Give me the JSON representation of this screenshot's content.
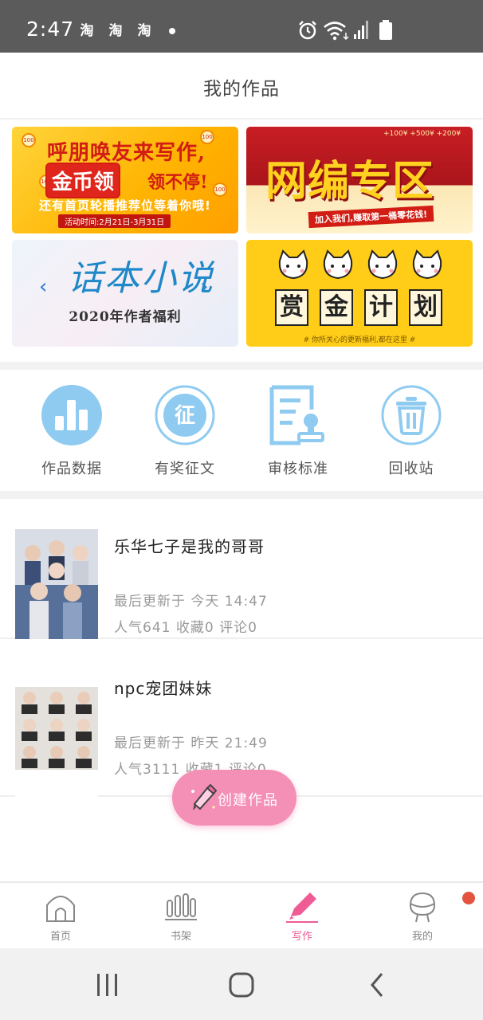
{
  "status_bar": {
    "time": "2:47",
    "app_icons": [
      "淘",
      "淘",
      "淘"
    ],
    "icons": [
      "alarm-icon",
      "wifi-icon",
      "signal-icon",
      "battery-icon"
    ]
  },
  "header": {
    "title": "我的作品"
  },
  "banners": [
    {
      "line1": "呼朋唤友来写作,",
      "highlight": "金币领",
      "tail": "领不停!",
      "line3": "还有首页轮播推荐位等着你哦!",
      "date": "活动时间:2月21日-3月31日"
    },
    {
      "title": "网编专区",
      "sub": "加入我们,赚取第一桶零花钱!",
      "money": "+100¥ +500¥ +200¥"
    },
    {
      "title": "话本小说",
      "sub": "2020年作者福利"
    },
    {
      "chars": [
        "赏",
        "金",
        "计",
        "划"
      ],
      "note": "# 你所关心的更新福利,都在这里 #"
    }
  ],
  "actions": [
    {
      "label": "作品数据",
      "icon": "bar-chart-icon"
    },
    {
      "label": "有奖征文",
      "icon": "contest-icon"
    },
    {
      "label": "审核标准",
      "icon": "review-document-icon"
    },
    {
      "label": "回收站",
      "icon": "trash-icon"
    }
  ],
  "works": [
    {
      "title": "乐华七子是我的哥哥",
      "updated": "最后更新于 今天 14:47",
      "stats": "人气641 收藏0 评论0"
    },
    {
      "title": "npc宠团妹妹",
      "updated": "最后更新于 昨天 21:49",
      "stats": "人气3111 收藏1 评论0"
    }
  ],
  "fab": {
    "label": "创建作品",
    "icon": "pencil-icon"
  },
  "tabs": [
    {
      "label": "首页",
      "icon": "home-icon",
      "active": false
    },
    {
      "label": "书架",
      "icon": "bookshelf-icon",
      "active": false
    },
    {
      "label": "写作",
      "icon": "write-pencil-icon",
      "active": true
    },
    {
      "label": "我的",
      "icon": "profile-icon",
      "active": false
    }
  ],
  "nav": [
    "recents-icon",
    "home-button-icon",
    "back-icon"
  ],
  "colors": {
    "accent": "#ef5b95",
    "icon_blue": "#8fcbf1",
    "fab": "#f48fb5"
  }
}
